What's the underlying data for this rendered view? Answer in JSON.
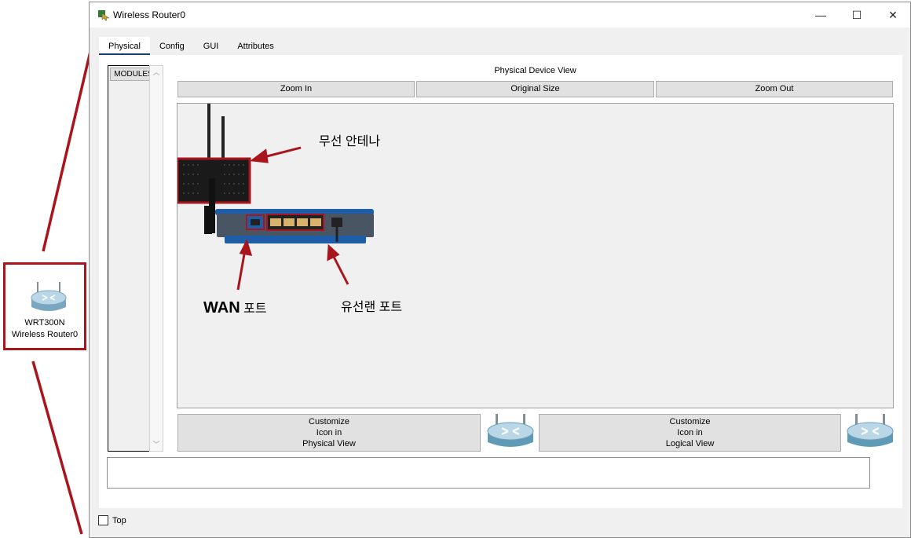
{
  "window": {
    "title": "Wireless Router0",
    "controls": {
      "minimize": "—",
      "maximize": "☐",
      "close": "✕"
    }
  },
  "tabs": [
    {
      "label": "Physical",
      "active": true
    },
    {
      "label": "Config",
      "active": false
    },
    {
      "label": "GUI",
      "active": false
    },
    {
      "label": "Attributes",
      "active": false
    }
  ],
  "physical": {
    "modules_label": "MODULES",
    "view_title": "Physical Device View",
    "zoom_in": "Zoom In",
    "original_size": "Original Size",
    "zoom_out": "Zoom Out",
    "customize_physical": [
      "Customize",
      "Icon in",
      "Physical View"
    ],
    "customize_logical": [
      "Customize",
      "Icon in",
      "Logical View"
    ]
  },
  "annotations": {
    "antenna": "무선 안테나",
    "wan_strong": "WAN",
    "wan_rest": " 포트",
    "lan": "유선랜 포트"
  },
  "workspace_device": {
    "model": "WRT300N",
    "name": "Wireless Router0"
  },
  "footer": {
    "top_label": "Top",
    "top_checked": false
  },
  "colors": {
    "callout": "#a8151c",
    "tab_underline": "#1c3f66",
    "router_blue": "#1e5ea8"
  }
}
